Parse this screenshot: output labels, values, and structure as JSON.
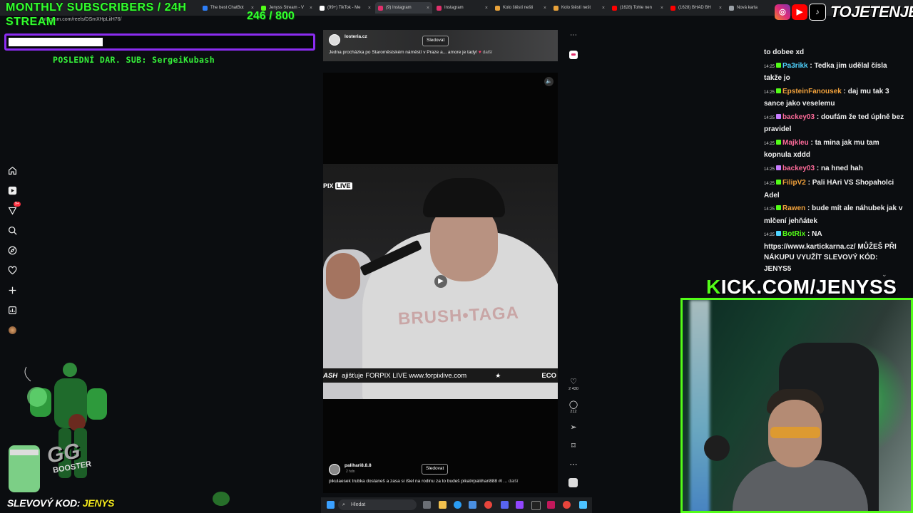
{
  "browser": {
    "tabs": [
      {
        "label": "The best ChatBot",
        "color": "#2d7ef7"
      },
      {
        "label": "Jenyss Stream - V",
        "color": "#53fc18"
      },
      {
        "label": "(99+) TikTok - Me",
        "color": "#ffffff"
      },
      {
        "label": "(9) Instagram",
        "color": "#e1306c"
      },
      {
        "label": "Instagram",
        "color": "#e1306c"
      },
      {
        "label": "Kolo štěstí nešti",
        "color": "#e8a23a"
      },
      {
        "label": "Kolo štěstí nešt",
        "color": "#e8a23a"
      },
      {
        "label": "(1628) Tohle nen",
        "color": "#ff0000"
      },
      {
        "label": "(1628) BHAD BH",
        "color": "#ff0000"
      },
      {
        "label": "Nová karta",
        "color": "#9aa0a6"
      }
    ],
    "url": "stagram.com/reels/DSmXHpLiiH76/"
  },
  "overlay": {
    "subs_title": "MONTHLY SUBSCRIBERS / 24H STREAM",
    "subs_current": "246",
    "subs_goal": "800",
    "subs_progress_pct": 30.75,
    "last_donation": "POSLEDNÍ DAR. SUB: SergeiKubash",
    "promo_label": "SLEVOVÝ KOD:",
    "promo_code": "JENYS",
    "booster_text": "GG",
    "booster_sub": "BOOSTER",
    "kick_k": "K",
    "kick_rest": "ICK.COM/JENYSS",
    "brand": "TOJETENJENYS"
  },
  "instagram": {
    "nav_icons": [
      "home-icon",
      "reels-icon",
      "notifications-icon",
      "search-icon",
      "explore-icon",
      "heart-icon",
      "create-icon",
      "dashboard-icon",
      "profile-avatar"
    ],
    "nav_badge": "9+",
    "top_post": {
      "account": "losteria.cz",
      "follow": "Sledovat",
      "caption": "Jedna procházka po Staroměstském náměstí v Praze a... amore je tady! ",
      "more": "další"
    },
    "reel": {
      "live_prefix": "PIX",
      "live_label": "LIVE",
      "ticker_brand": "ASH",
      "ticker_text": "ajišťuje FORPIX LIVE www.forpixlive.com",
      "ticker_star": "★",
      "ticker_end": "ECO",
      "hoodie_text": "BRUSH•TAGA",
      "account": "palihari8.8.8",
      "time": "2 hdn",
      "follow": "Sledovat",
      "caption": "pikulaesek trubka dostaneš a zasa si išiel na rodinu za to budeš pikat#paliihari888 #l ...",
      "more": "další"
    },
    "actions": {
      "likes": "2 430",
      "comments": "212"
    }
  },
  "chat": [
    {
      "ts": "",
      "user": "",
      "color": "#f0f0f0",
      "badge": "",
      "text": "to dobee xd"
    },
    {
      "ts": "14:25",
      "user": "Pa3rikk",
      "color": "#4fd3ff",
      "badge": "#53fc18",
      "text": ": Tedka jim udělal čísla takže jo"
    },
    {
      "ts": "14:25",
      "user": "EpsteinFanousek",
      "color": "#f2a23c",
      "badge": "#53fc18",
      "text": ": daj mu tak 3 sance jako veselemu"
    },
    {
      "ts": "14:25",
      "user": "backey03",
      "color": "#ff6b9a",
      "badge": "#c77dff",
      "text": ": doufám že ted úplně bez pravidel"
    },
    {
      "ts": "14:25",
      "user": "Majkleu",
      "color": "#ff6b9a",
      "badge": "#53fc18",
      "text": ": ta mina jak mu tam kopnula xddd"
    },
    {
      "ts": "14:25",
      "user": "backey03",
      "color": "#ff6b9a",
      "badge": "#c77dff",
      "text": ": na hned hah"
    },
    {
      "ts": "14:25",
      "user": "FilipV2",
      "color": "#f2a23c",
      "badge": "#53fc18",
      "text": ": Pali HAri VS Shopaholci Adel"
    },
    {
      "ts": "14:25",
      "user": "Rawen",
      "color": "#f2a23c",
      "badge": "#53fc18",
      "text": ": bude mít ale náhubek jak v mlčení jehňátek"
    },
    {
      "ts": "14:25",
      "user": "BotRix",
      "color": "#53fc18",
      "badge": "#4fd3ff",
      "text": ": NA https://www.kartickarna.cz/ MŮŽEŠ PŘI NÁKUPU VYUŽÍT SLEVOVÝ KÓD: JENYS5"
    }
  ],
  "taskbar": {
    "search_placeholder": "Hledat"
  }
}
